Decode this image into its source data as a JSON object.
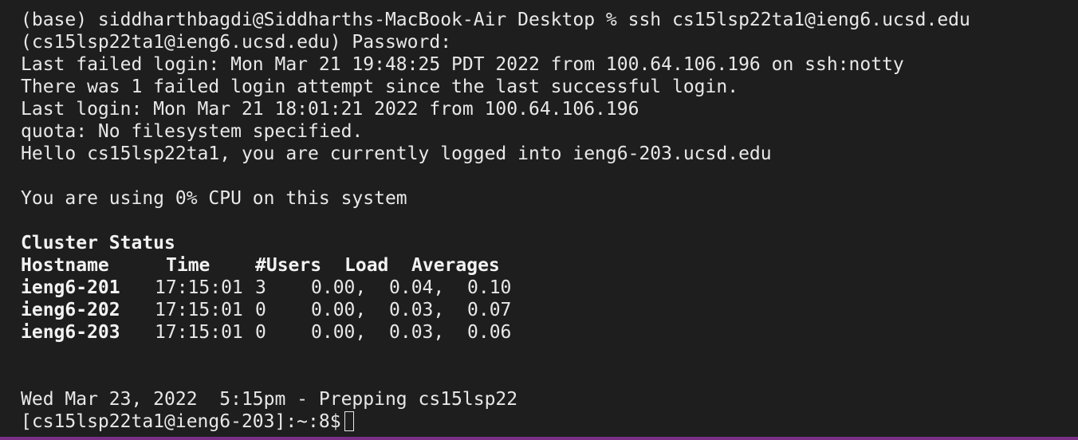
{
  "terminal": {
    "lines": [
      "(base) siddharthbagdi@Siddharths-MacBook-Air Desktop % ssh cs15lsp22ta1@ieng6.ucsd.edu",
      "(cs15lsp22ta1@ieng6.ucsd.edu) Password:",
      "Last failed login: Mon Mar 21 19:48:25 PDT 2022 from 100.64.106.196 on ssh:notty",
      "There was 1 failed login attempt since the last successful login.",
      "Last login: Mon Mar 21 18:01:21 2022 from 100.64.106.196",
      "quota: No filesystem specified.",
      "Hello cs15lsp22ta1, you are currently logged into ieng6-203.ucsd.edu",
      "You are using 0% CPU on this system"
    ],
    "cluster": {
      "title": "Cluster Status",
      "headers": [
        "Hostname",
        "Time",
        "#Users",
        "Load",
        "Averages"
      ],
      "rows": [
        [
          "ieng6-201",
          "17:15:01",
          "3",
          "0.00,",
          "0.04,",
          "0.10"
        ],
        [
          "ieng6-202",
          "17:15:01",
          "0",
          "0.00,",
          "0.03,",
          "0.07"
        ],
        [
          "ieng6-203",
          "17:15:01",
          "0",
          "0.00,",
          "0.03,",
          "0.06"
        ]
      ]
    },
    "motd": "Wed Mar 23, 2022  5:15pm - Prepping cs15lsp22",
    "prompt": "[cs15lsp22ta1@ieng6-203]:~:8$"
  },
  "colors": {
    "background": "#1e1e1e",
    "foreground": "#e8e8e8",
    "accent_bar": "#7a2f86"
  }
}
